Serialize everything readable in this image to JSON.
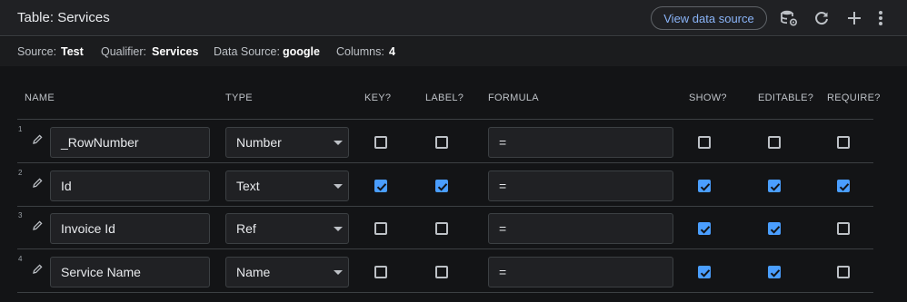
{
  "header": {
    "title": "Table: Services",
    "view_data_source_label": "View data source"
  },
  "meta": {
    "source_label": "Source:",
    "source_value": "Test",
    "qualifier_label": "Qualifier:",
    "qualifier_value": "Services",
    "datasource_label": "Data Source:",
    "datasource_value": "google",
    "columns_label": "Columns:",
    "columns_value": "4"
  },
  "columns": {
    "name": "NAME",
    "type": "TYPE",
    "key": "KEY?",
    "label": "LABEL?",
    "formula": "FORMULA",
    "show": "SHOW?",
    "editable": "EDITABLE?",
    "require": "REQUIRE?"
  },
  "rows": [
    {
      "num": "1",
      "name": "_RowNumber",
      "type": "Number",
      "formula": "=",
      "key": false,
      "label": false,
      "show": false,
      "editable": false,
      "require": false
    },
    {
      "num": "2",
      "name": "Id",
      "type": "Text",
      "formula": "=",
      "key": true,
      "label": true,
      "show": true,
      "editable": true,
      "require": true
    },
    {
      "num": "3",
      "name": "Invoice Id",
      "type": "Ref",
      "formula": "=",
      "key": false,
      "label": false,
      "show": true,
      "editable": true,
      "require": false
    },
    {
      "num": "4",
      "name": "Service Name",
      "type": "Name",
      "formula": "=",
      "key": false,
      "label": false,
      "show": true,
      "editable": true,
      "require": false
    }
  ],
  "icons": {
    "header": [
      "database-settings-icon",
      "refresh-icon",
      "add-icon",
      "more-vert-icon"
    ],
    "row": "pencil-icon",
    "checkbox_checked": "check-icon"
  },
  "colors": {
    "accent": "#8ab4f8",
    "checkbox": "#4a9eff"
  }
}
